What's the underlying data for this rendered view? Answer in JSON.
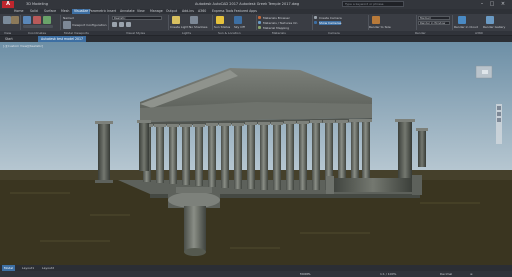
{
  "titlebar": {
    "app_logo": "A",
    "workspace": "3D Modeling",
    "title": "Autodesk AutoCAD 2017  Autodesk Greek Temple 2017.dwg",
    "search_placeholder": "Type a keyword or phrase"
  },
  "ribbon_tabs": [
    "Home",
    "Solid",
    "Surface",
    "Mesh",
    "Visualize",
    "Parametric",
    "Insert",
    "Annotate",
    "View",
    "Manage",
    "Output",
    "Add-ins",
    "A360",
    "Express Tools",
    "Featured Apps"
  ],
  "ribbon": {
    "group_titles": [
      "View",
      "Coordinates",
      "Model Viewports",
      "Visual Styles",
      "Lights",
      "Sun & Location",
      "Materials",
      "Camera",
      "Render",
      "A360"
    ],
    "named_views_label": "Named",
    "viewport_config_label": "Viewport Configuration",
    "visual_style_value": "Realistic",
    "create_light_label": "Create Light",
    "no_shadows_label": "No Shadows",
    "sun_status_label": "Sun Status",
    "sky_off_label": "Sky Off",
    "materials_browser_label": "Materials Browser",
    "materials_textures_label": "Materials / Textures On",
    "material_mapping_label": "Material Mapping",
    "create_camera_label": "Create Camera",
    "show_cameras_label": "Show Cameras",
    "render_to_size_label": "Render to Size",
    "render_quality_value": "Medium",
    "render_in_window_value": "Render in Window",
    "render_in_cloud_label": "Render in Cloud",
    "render_gallery_label": "Render Gallery"
  },
  "file_tabs": [
    "Start",
    "Autodesk test model 2017"
  ],
  "viewport_label": "[-][Custom View][Realistic]",
  "layout_tabs": [
    "Model",
    "Layout1",
    "Layout2"
  ],
  "statusbar": {
    "model_label": "MODEL",
    "coords": "1:1 / 100%",
    "decimal_label": "Decimal"
  },
  "colors": {
    "accent": "#3d6fa3",
    "sky_top": "#6d8fa6",
    "sky_bottom": "#aabdc9",
    "ground": "#3a3520",
    "stone": "#6b6f68",
    "brand": "#c0262d"
  }
}
